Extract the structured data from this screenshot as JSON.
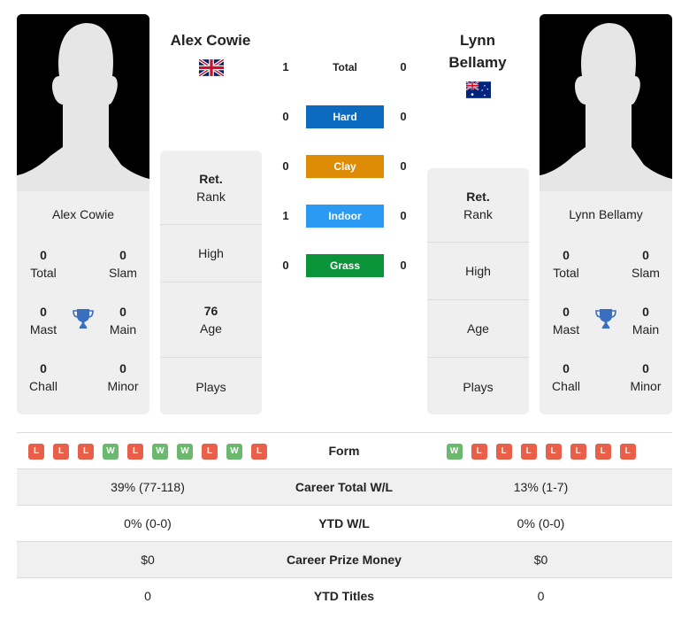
{
  "player1": {
    "name": "Alex Cowie",
    "card_name": "Alex Cowie",
    "flag": "united-kingdom",
    "titles": {
      "total": "0",
      "total_label": "Total",
      "slam": "0",
      "slam_label": "Slam",
      "mast": "0",
      "mast_label": "Mast",
      "main": "0",
      "main_label": "Main",
      "chall": "0",
      "chall_label": "Chall",
      "minor": "0",
      "minor_label": "Minor"
    },
    "info": {
      "rank_value": "Ret.",
      "rank_label": "Rank",
      "high_label": "High",
      "age_value": "76",
      "age_label": "Age",
      "plays_label": "Plays"
    },
    "form": [
      "L",
      "L",
      "L",
      "W",
      "L",
      "W",
      "W",
      "L",
      "W",
      "L"
    ]
  },
  "player2": {
    "name_line1": "Lynn",
    "name_line2": "Bellamy",
    "card_name": "Lynn Bellamy",
    "flag": "australia",
    "titles": {
      "total": "0",
      "total_label": "Total",
      "slam": "0",
      "slam_label": "Slam",
      "mast": "0",
      "mast_label": "Mast",
      "main": "0",
      "main_label": "Main",
      "chall": "0",
      "chall_label": "Chall",
      "minor": "0",
      "minor_label": "Minor"
    },
    "info": {
      "rank_value": "Ret.",
      "rank_label": "Rank",
      "high_label": "High",
      "age_label": "Age",
      "plays_label": "Plays"
    },
    "form": [
      "W",
      "L",
      "L",
      "L",
      "L",
      "L",
      "L",
      "L"
    ]
  },
  "h2h": [
    {
      "label": "Total",
      "p1": "1",
      "p2": "0",
      "color": ""
    },
    {
      "label": "Hard",
      "p1": "0",
      "p2": "0",
      "color": "#0a6bbf"
    },
    {
      "label": "Clay",
      "p1": "0",
      "p2": "0",
      "color": "#de8c06"
    },
    {
      "label": "Indoor",
      "p1": "1",
      "p2": "0",
      "color": "#2b9af3"
    },
    {
      "label": "Grass",
      "p1": "0",
      "p2": "0",
      "color": "#0a9339"
    }
  ],
  "table": {
    "form_label": "Form",
    "rows": [
      {
        "label": "Career Total W/L",
        "p1": "39% (77-118)",
        "p2": "13% (1-7)"
      },
      {
        "label": "YTD W/L",
        "p1": "0% (0-0)",
        "p2": "0% (0-0)"
      },
      {
        "label": "Career Prize Money",
        "p1": "$0",
        "p2": "$0"
      },
      {
        "label": "YTD Titles",
        "p1": "0",
        "p2": "0"
      }
    ]
  }
}
